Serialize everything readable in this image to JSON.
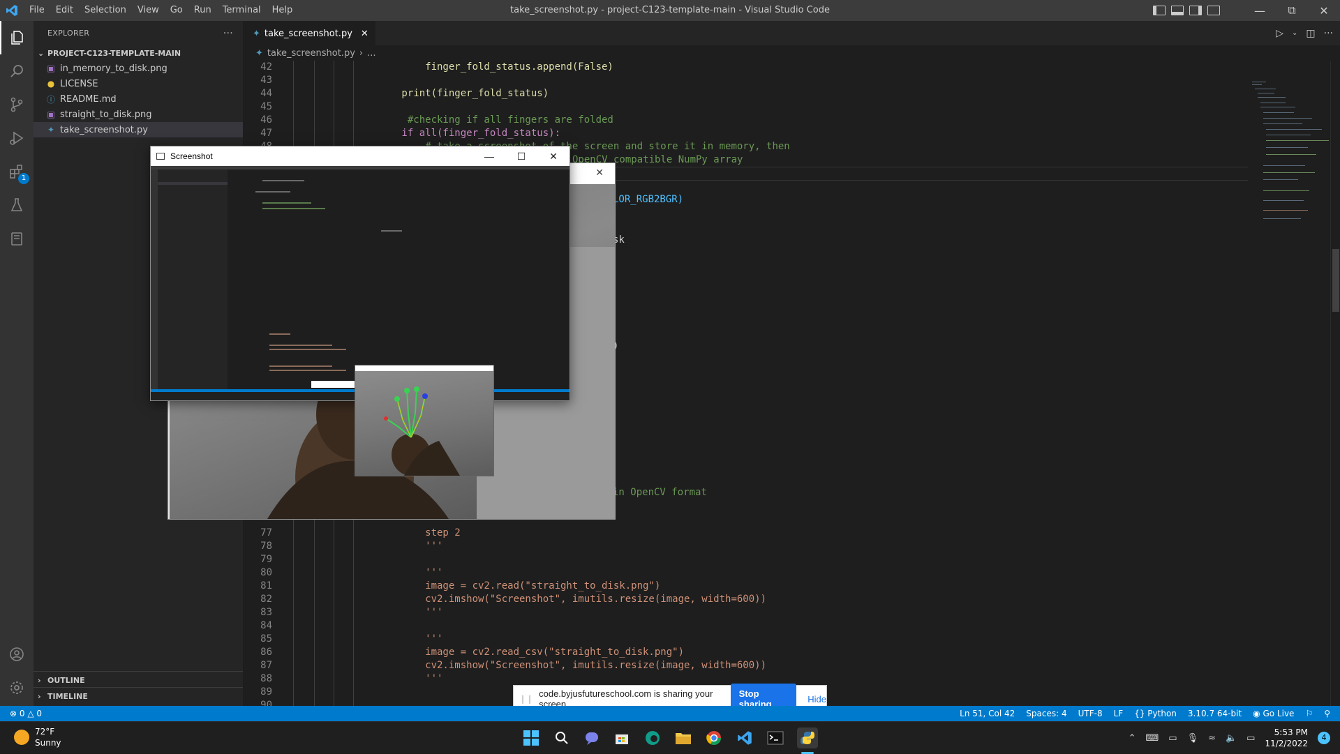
{
  "window": {
    "title": "take_screenshot.py - project-C123-template-main - Visual Studio Code"
  },
  "menu": [
    "File",
    "Edit",
    "Selection",
    "View",
    "Go",
    "Run",
    "Terminal",
    "Help"
  ],
  "activity": {
    "extensions_badge": "1"
  },
  "explorer": {
    "header": "EXPLORER",
    "more": "···",
    "root": "PROJECT-C123-TEMPLATE-MAIN",
    "files": [
      {
        "name": "in_memory_to_disk.png",
        "icon": "image-file-icon"
      },
      {
        "name": "LICENSE",
        "icon": "license-file-icon"
      },
      {
        "name": "README.md",
        "icon": "info-file-icon"
      },
      {
        "name": "straight_to_disk.png",
        "icon": "image-file-icon"
      },
      {
        "name": "take_screenshot.py",
        "icon": "python-file-icon"
      }
    ],
    "outline": "OUTLINE",
    "timeline": "TIMELINE"
  },
  "tab": {
    "label": "take_screenshot.py"
  },
  "breadcrumb": {
    "file": "take_screenshot.py",
    "rest": "..."
  },
  "code_top": [
    {
      "n": "42",
      "t": "            finger_fold_status.append(False)"
    },
    {
      "n": "43",
      "t": ""
    },
    {
      "n": "44",
      "t": "        print(finger_fold_status)"
    },
    {
      "n": "45",
      "t": ""
    },
    {
      "n": "46",
      "t": "         #checking if all fingers are folded"
    },
    {
      "n": "47",
      "t": "        if all(finger_fold_status):"
    },
    {
      "n": "48",
      "t": "            # take a screenshot of the screen and store it in memory, then"
    }
  ],
  "code_frag": {
    "convert": "OpenCV compatible NumPy array",
    "rgb": "LOR_RGB2BGR)",
    "sk": "sk",
    "paren": ")",
    "fmt": "in OpenCV format"
  },
  "code_bottom": [
    {
      "n": "77",
      "t": "            step 2"
    },
    {
      "n": "78",
      "t": "            '''"
    },
    {
      "n": "79",
      "t": ""
    },
    {
      "n": "80",
      "t": "            '''"
    },
    {
      "n": "81",
      "t": "            image = cv2.read(\"straight_to_disk.png\")"
    },
    {
      "n": "82",
      "t": "            cv2.imshow(\"Screenshot\", imutils.resize(image, width=600))"
    },
    {
      "n": "83",
      "t": "            '''"
    },
    {
      "n": "84",
      "t": ""
    },
    {
      "n": "85",
      "t": "            '''"
    },
    {
      "n": "86",
      "t": "            image = cv2.read_csv(\"straight_to_disk.png\")"
    },
    {
      "n": "87",
      "t": "            cv2.imshow(\"Screenshot\", imutils.resize(image, width=600))"
    },
    {
      "n": "88",
      "t": "            '''"
    },
    {
      "n": "89",
      "t": ""
    },
    {
      "n": "90",
      "t": ""
    }
  ],
  "screenshot_window": {
    "title": "Screenshot"
  },
  "status": {
    "errors": "0",
    "warnings": "0",
    "position": "Ln 51, Col 42",
    "spaces": "Spaces: 4",
    "encoding": "UTF-8",
    "eol": "LF",
    "language": "Python",
    "interpreter": "3.10.7 64-bit",
    "golive": "Go Live"
  },
  "share": {
    "text": "code.byjusfutureschool.com is sharing your screen.",
    "stop": "Stop sharing",
    "hide": "Hide"
  },
  "taskbar": {
    "temp": "72°F",
    "weather": "Sunny",
    "time": "5:53 PM",
    "date": "11/2/2022",
    "notif_count": "4",
    "apps": [
      "windows-start-icon",
      "search-icon",
      "teams-chat-icon",
      "store-icon",
      "edge-icon",
      "file-explorer-icon",
      "chrome-icon",
      "vscode-icon",
      "terminal-icon",
      "python-icon"
    ]
  },
  "colors": {
    "accent": "#007acc",
    "keyword": "#c586c0",
    "string": "#ce9178",
    "comment": "#6a9955",
    "function": "#dcdcaa"
  }
}
